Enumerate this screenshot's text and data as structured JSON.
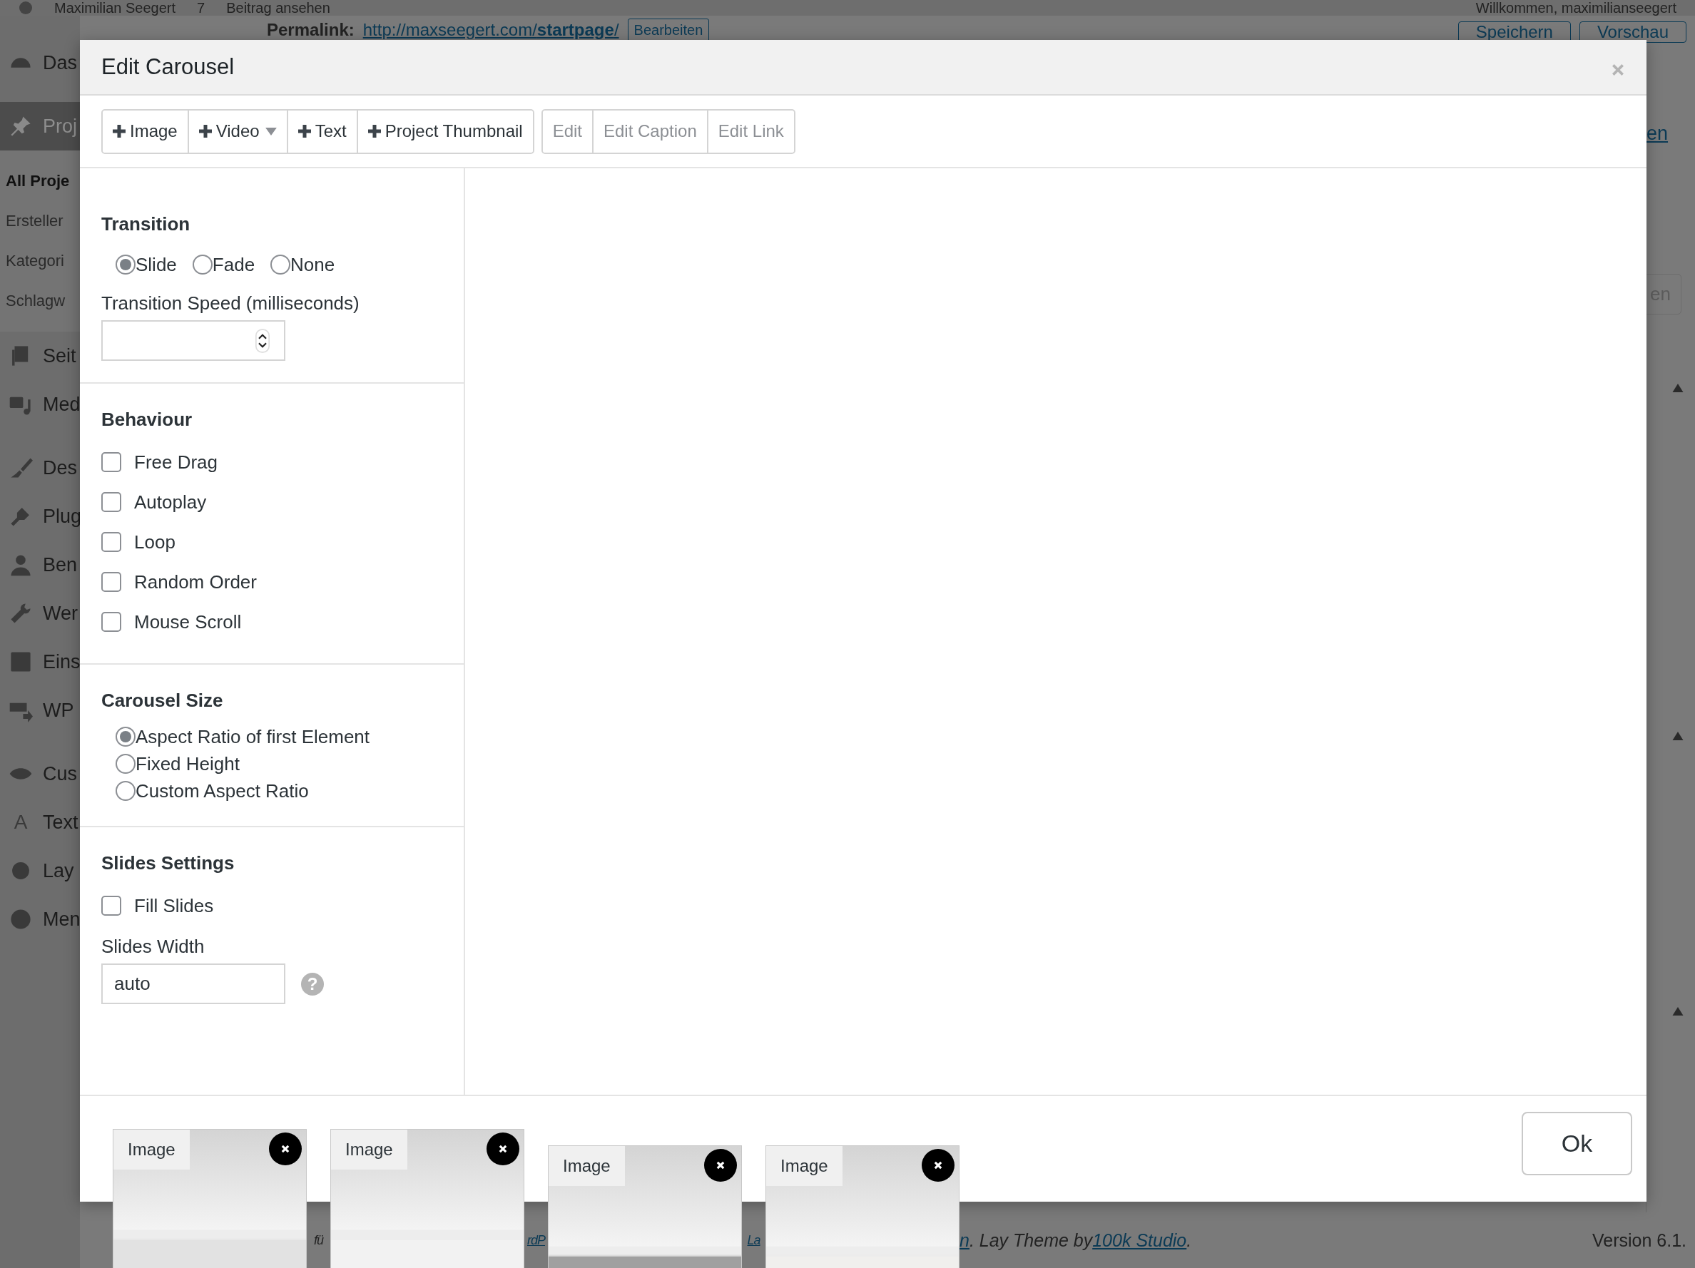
{
  "admin_bar": {
    "items": [
      "Maximilian Seegert",
      "7",
      "Beitrag ansehen"
    ],
    "greeting": "Willkommen, maximilianseegert"
  },
  "editor_header": {
    "permalink_label": "Permalink:",
    "permalink_url": "http://maxseegert.com/**startpage**/",
    "edit_button": "Bearbeiten",
    "buttons": [
      "Speichern",
      "Vorschau"
    ]
  },
  "sidebar": {
    "groups": [
      [
        {
          "label": "Das",
          "selected": false
        }
      ],
      [
        {
          "label": "Proj",
          "selected": true,
          "children": [
            {
              "label": "All Proje",
              "selected": true
            },
            {
              "label": "Ersteller",
              "selected": false
            },
            {
              "label": "Kategori",
              "selected": false
            },
            {
              "label": "Schlagw",
              "selected": false
            }
          ]
        },
        {
          "label": "Seit",
          "selected": false
        },
        {
          "label": "Med",
          "selected": false
        }
      ],
      [
        {
          "label": "Des",
          "selected": false
        },
        {
          "label": "Plug",
          "selected": false
        },
        {
          "label": "Ben",
          "selected": false
        },
        {
          "label": "Wer",
          "selected": false
        },
        {
          "label": "Eins",
          "selected": false
        },
        {
          "label": "WP",
          "selected": false
        }
      ],
      [
        {
          "label": "Cus",
          "selected": false
        },
        {
          "label": "Text",
          "selected": false,
          "glyph": "A"
        },
        {
          "label": "Lay",
          "selected": false
        },
        {
          "label": "Men",
          "selected": false
        }
      ]
    ]
  },
  "right_edge": {
    "link": "en",
    "button": "en"
  },
  "modal": {
    "title": "Edit Carousel",
    "toolbar": [
      {
        "buttons": [
          {
            "label": "Image",
            "kind": "add",
            "dropdown": false,
            "disabled": false
          },
          {
            "label": "Video",
            "kind": "add",
            "dropdown": true,
            "disabled": false
          },
          {
            "label": "Text",
            "kind": "add",
            "dropdown": false,
            "disabled": false
          },
          {
            "label": "Project Thumbnail",
            "kind": "add",
            "dropdown": false,
            "disabled": false
          }
        ]
      },
      {
        "buttons": [
          {
            "label": "Edit",
            "kind": "edit",
            "dropdown": false,
            "disabled": true
          },
          {
            "label": "Edit Caption",
            "kind": "edit",
            "dropdown": false,
            "disabled": true
          },
          {
            "label": "Edit Link",
            "kind": "edit",
            "dropdown": false,
            "disabled": true
          }
        ]
      }
    ],
    "sections": [
      {
        "title": "Transition",
        "fields": [
          {
            "kind": "radio_row",
            "options": [
              {
                "label": "Slide",
                "selected": true
              },
              {
                "label": "Fade",
                "selected": false
              },
              {
                "label": "None",
                "selected": false
              }
            ]
          },
          {
            "kind": "number",
            "label": "Transition Speed (milliseconds)"
          }
        ]
      },
      {
        "title": "Behaviour",
        "fields": [
          {
            "kind": "checkbox",
            "label": "Free Drag",
            "checked": false
          },
          {
            "kind": "checkbox",
            "label": "Autoplay",
            "checked": false
          },
          {
            "kind": "checkbox",
            "label": "Loop",
            "checked": false
          },
          {
            "kind": "checkbox",
            "label": "Random Order",
            "checked": false
          },
          {
            "kind": "checkbox",
            "label": "Mouse Scroll",
            "checked": false
          }
        ]
      },
      {
        "title": "Carousel Size",
        "fields": [
          {
            "kind": "radio_list",
            "options": [
              {
                "label": "Aspect Ratio of first Element",
                "selected": true
              },
              {
                "label": "Fixed Height",
                "selected": false
              },
              {
                "label": "Custom Aspect Ratio",
                "selected": false
              }
            ]
          }
        ]
      },
      {
        "title": "Slides Settings",
        "fields": [
          {
            "kind": "checkbox",
            "label": "Fill Slides",
            "checked": false
          },
          {
            "kind": "text",
            "label": "Slides Width",
            "value": "auto",
            "help": "?"
          }
        ]
      }
    ],
    "slides": [
      {
        "label": "Image"
      },
      {
        "label": "Image"
      },
      {
        "label": "Image"
      },
      {
        "label": "Image"
      }
    ],
    "ok_button": "Ok"
  },
  "footer": {
    "fragments": [
      {
        "text": "fü",
        "link": false
      },
      {
        "text": "rdP",
        "link": true
      },
      {
        "text": "La",
        "link": true
      },
      {
        "text": "n",
        "link": true
      },
      {
        "text": ". Lay Theme by ",
        "link": false
      },
      {
        "text": "100k Studio",
        "link": true
      },
      {
        "text": ".",
        "link": false
      }
    ],
    "version": "Version 6.1."
  }
}
